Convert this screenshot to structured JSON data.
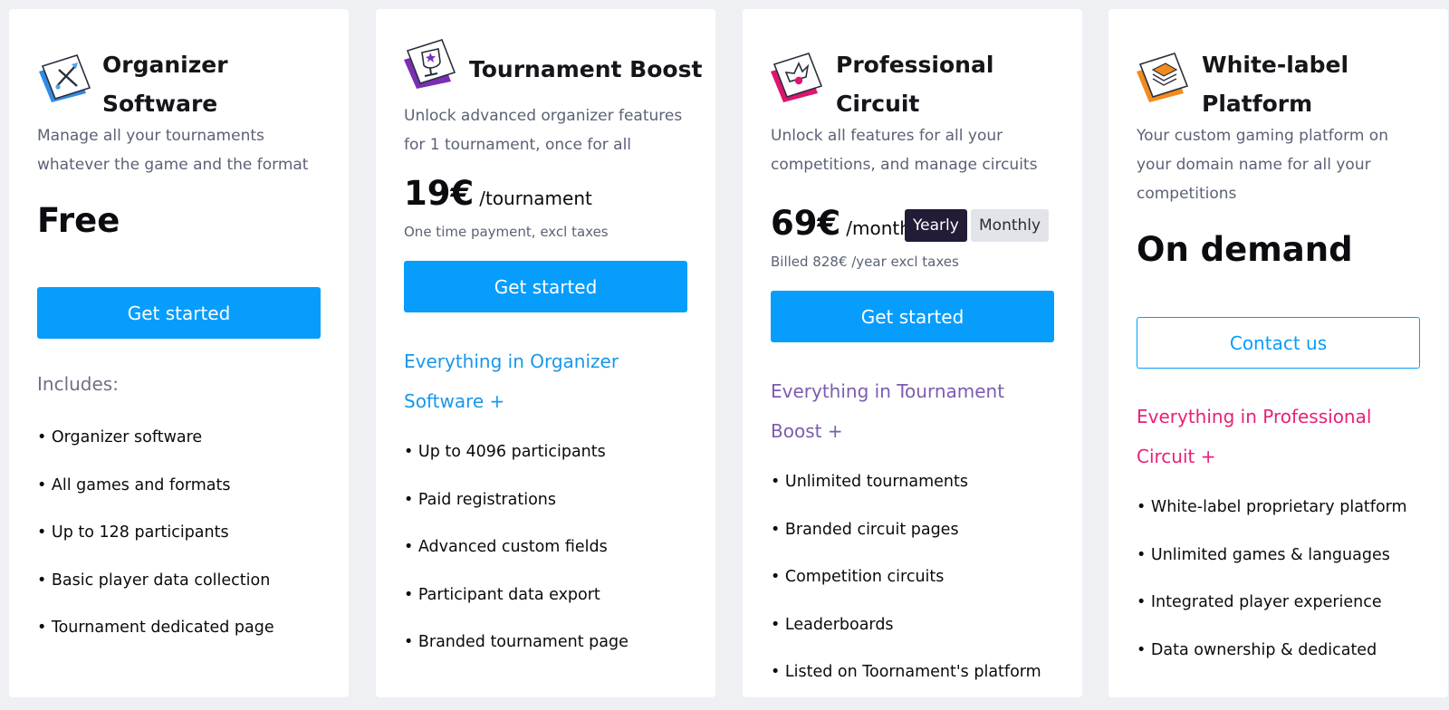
{
  "colors": {
    "page_bg": "#eef0f4",
    "accent_blue": "#069dfd",
    "title_dark": "#15151a",
    "muted_text": "#5b6275",
    "purple": "#7b5cb0",
    "pink": "#e8207a",
    "orange": "#f28b1d",
    "yearly_bg": "#231c37"
  },
  "plans": [
    {
      "icon": "crossed-swords-card-icon",
      "title": "Organizer Software",
      "description": "Manage all your tournaments whatever the game and the format",
      "price": "Free",
      "cta": "Get started",
      "includes_label": "Includes:",
      "features": [
        "• Organizer software",
        "• All games and formats",
        "• Up to 128 participants",
        "• Basic player data collection",
        "• Tournament dedicated page"
      ]
    },
    {
      "icon": "trophy-card-icon",
      "title": "Tournament Boost",
      "description": "Unlock advanced organizer features for 1 tournament, once for all",
      "price": "19€",
      "price_unit": "/tournament",
      "price_note": "One time payment, excl taxes",
      "cta": "Get started",
      "everything": "Everything in Organizer Software +",
      "features": [
        "• Up to 4096 participants",
        "• Paid registrations",
        "• Advanced custom fields",
        "• Participant data export",
        "• Branded tournament page"
      ]
    },
    {
      "icon": "crown-card-icon",
      "title": "Professional Circuit",
      "description": "Unlock all features for all your competitions, and manage circuits",
      "price": "69€",
      "price_unit": "/month",
      "toggle_yearly": "Yearly",
      "toggle_monthly": "Monthly",
      "price_note": "Billed 828€ /year excl taxes",
      "cta": "Get started",
      "everything": "Everything in Tournament Boost +",
      "features": [
        "• Unlimited tournaments",
        "• Branded circuit pages",
        "• Competition circuits",
        "• Leaderboards",
        "• Listed on Toornament's platform"
      ]
    },
    {
      "icon": "layers-card-icon",
      "title": "White-label Platform",
      "description": "Your custom gaming platform on your domain name for all your competitions",
      "price": "On demand",
      "cta": "Contact us",
      "everything": "Everything in Professional Circuit +",
      "features": [
        "• White-label proprietary platform",
        "• Unlimited games & languages",
        "• Integrated player experience",
        "• Data ownership & dedicated"
      ]
    }
  ]
}
